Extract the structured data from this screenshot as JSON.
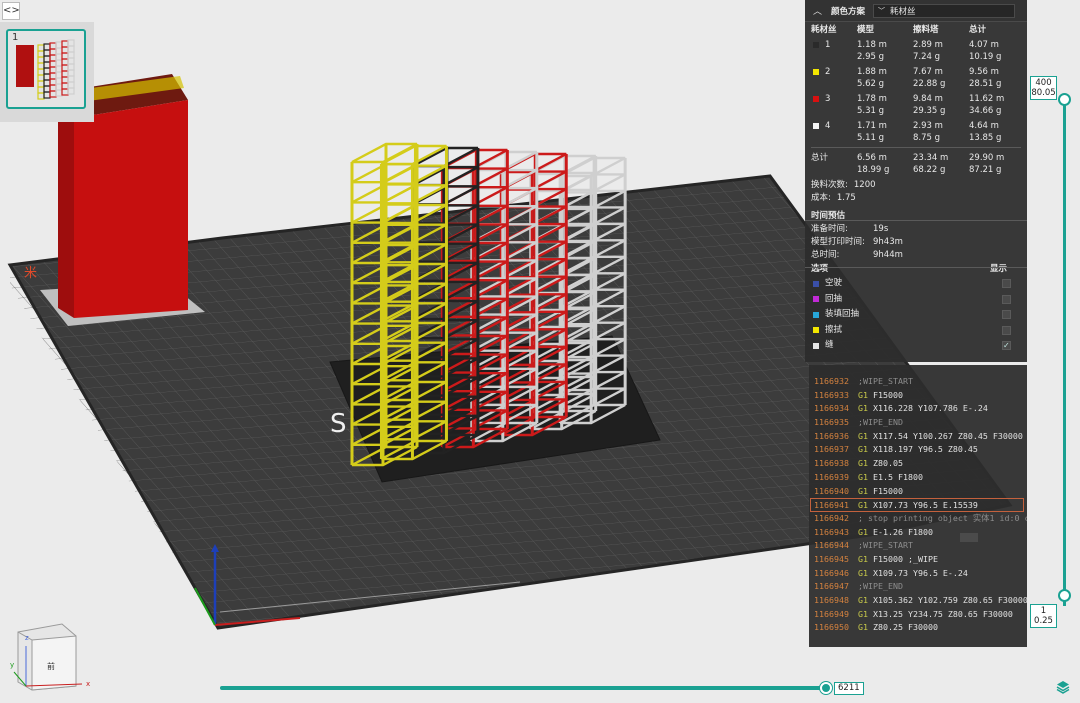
{
  "thumbnail": {
    "index": "1"
  },
  "color_scheme": {
    "title": "颜色方案",
    "selected": "耗材丝"
  },
  "filament_table": {
    "headers": [
      "耗材丝",
      "模型",
      "擦料塔",
      "总计"
    ],
    "rows": [
      {
        "id": "1",
        "color": "#2a2a2a",
        "model_len": "1.18 m",
        "model_wt": "2.95 g",
        "tower_len": "2.89 m",
        "tower_wt": "7.24 g",
        "total_len": "4.07 m",
        "total_wt": "10.19 g"
      },
      {
        "id": "2",
        "color": "#f2e600",
        "model_len": "1.88 m",
        "model_wt": "5.62 g",
        "tower_len": "7.67 m",
        "tower_wt": "22.88 g",
        "total_len": "9.56 m",
        "total_wt": "28.51 g"
      },
      {
        "id": "3",
        "color": "#d81010",
        "model_len": "1.78 m",
        "model_wt": "5.31 g",
        "tower_len": "9.84 m",
        "tower_wt": "29.35 g",
        "total_len": "11.62 m",
        "total_wt": "34.66 g"
      },
      {
        "id": "4",
        "color": "#f5f5f5",
        "model_len": "1.71 m",
        "model_wt": "5.11 g",
        "tower_len": "2.93 m",
        "tower_wt": "8.75 g",
        "total_len": "4.64 m",
        "total_wt": "13.85 g"
      }
    ],
    "total": {
      "label": "总计",
      "model_len": "6.56 m",
      "model_wt": "18.99 g",
      "tower_len": "23.34 m",
      "tower_wt": "68.22 g",
      "total_len": "29.90 m",
      "total_wt": "87.21 g"
    }
  },
  "stats": {
    "changes_label": "换料次数:",
    "changes_value": "1200",
    "cost_label": "成本:",
    "cost_value": "1.75"
  },
  "time_estimate": {
    "title": "时间预估",
    "rows": [
      {
        "label": "准备时间:",
        "value": "19s"
      },
      {
        "label": "模型打印时间:",
        "value": "9h43m"
      },
      {
        "label": "总时间:",
        "value": "9h44m"
      }
    ]
  },
  "options": {
    "title": "选项",
    "show_label": "显示",
    "items": [
      {
        "label": "空驶",
        "color": "#3a4fa8",
        "checked": false
      },
      {
        "label": "回抽",
        "color": "#c12ad6",
        "checked": false
      },
      {
        "label": "装填回抽",
        "color": "#27a6d9",
        "checked": false
      },
      {
        "label": "擦拭",
        "color": "#f2e600",
        "checked": false
      },
      {
        "label": "缝",
        "color": "#e6e6e6",
        "checked": true
      }
    ]
  },
  "gcode": [
    {
      "num": "1166932",
      "cmd": "",
      "text": ";WIPE_START",
      "comment": true
    },
    {
      "num": "1166933",
      "cmd": "G1",
      "text": "F15000"
    },
    {
      "num": "1166934",
      "cmd": "G1",
      "text": "X116.228 Y107.786 E-.24"
    },
    {
      "num": "1166935",
      "cmd": "",
      "text": ";WIPE_END",
      "comment": true
    },
    {
      "num": "1166936",
      "cmd": "G1",
      "text": "X117.54 Y100.267 Z80.45 F30000"
    },
    {
      "num": "1166937",
      "cmd": "G1",
      "text": "X118.197 Y96.5 Z80.45"
    },
    {
      "num": "1166938",
      "cmd": "G1",
      "text": "Z80.05"
    },
    {
      "num": "1166939",
      "cmd": "G1",
      "text": "E1.5 F1800"
    },
    {
      "num": "1166940",
      "cmd": "G1",
      "text": "F15000"
    },
    {
      "num": "1166941",
      "cmd": "G1",
      "text": "X107.73 Y96.5 E.15539",
      "highlight": true
    },
    {
      "num": "1166942",
      "cmd": "",
      "text": "; stop printing object 实体1 id:0 copy 0",
      "comment": true
    },
    {
      "num": "1166943",
      "cmd": "G1",
      "text": "E-1.26 F1800"
    },
    {
      "num": "1166944",
      "cmd": "",
      "text": ";WIPE_START",
      "comment": true
    },
    {
      "num": "1166945",
      "cmd": "G1",
      "text": "F15000 ;_WIPE"
    },
    {
      "num": "1166946",
      "cmd": "G1",
      "text": "X109.73 Y96.5 E-.24"
    },
    {
      "num": "1166947",
      "cmd": "",
      "text": ";WIPE_END",
      "comment": true
    },
    {
      "num": "1166948",
      "cmd": "G1",
      "text": "X105.362 Y102.759 Z80.65 F30000"
    },
    {
      "num": "1166949",
      "cmd": "G1",
      "text": "X13.25 Y234.75 Z80.65 F30000"
    },
    {
      "num": "1166950",
      "cmd": "G1",
      "text": "Z80.25 F30000"
    }
  ],
  "layer_slider": {
    "top_layer": "400",
    "top_height": "80.05",
    "bottom_layer": "1",
    "bottom_height": "0.25"
  },
  "move_slider": {
    "value": "6211"
  },
  "view_cube": {
    "face_label": "前",
    "axis_x": "x",
    "axis_y": "y",
    "axis_z": "z"
  },
  "bed_text": {
    "left_brand": "米",
    "plate_text": "S"
  }
}
